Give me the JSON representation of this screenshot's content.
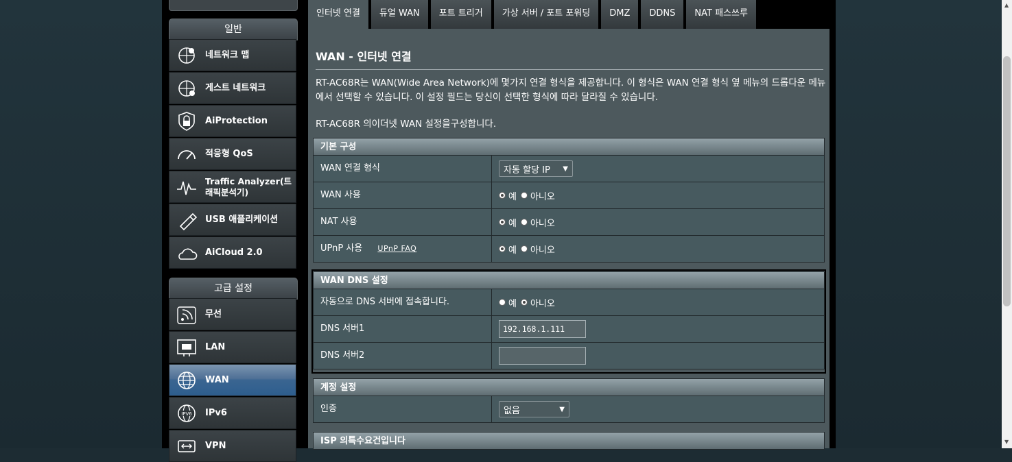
{
  "sidebar": {
    "group_general": "일반",
    "group_advanced": "고급 설정",
    "general_items": [
      {
        "label": "네트워크 맵",
        "icon": "network-map-icon"
      },
      {
        "label": "게스트 네트워크",
        "icon": "guest-network-icon"
      },
      {
        "label": "AiProtection",
        "icon": "lock-shield-icon"
      },
      {
        "label": "적응형 QoS",
        "icon": "speedometer-icon"
      },
      {
        "label": "Traffic Analyzer(트래픽분석기)",
        "icon": "traffic-analyzer-icon"
      },
      {
        "label": "USB 애플리케이션",
        "icon": "usb-icon"
      },
      {
        "label": "AiCloud 2.0",
        "icon": "cloud-icon"
      }
    ],
    "advanced_items": [
      {
        "label": "무선",
        "icon": "wireless-icon"
      },
      {
        "label": "LAN",
        "icon": "lan-icon"
      },
      {
        "label": "WAN",
        "icon": "globe-icon",
        "active": true
      },
      {
        "label": "IPv6",
        "icon": "ipv6-globe-icon"
      },
      {
        "label": "VPN",
        "icon": "vpn-icon"
      }
    ]
  },
  "tabs": [
    {
      "label": "인터넷 연결",
      "active": true
    },
    {
      "label": "듀얼 WAN"
    },
    {
      "label": "포트 트리거"
    },
    {
      "label": "가상 서버 / 포트 포워딩"
    },
    {
      "label": "DMZ"
    },
    {
      "label": "DDNS"
    },
    {
      "label": "NAT 패스쓰루"
    }
  ],
  "main": {
    "title": "WAN - 인터넷 연결",
    "description": "RT-AC68R는 WAN(Wide Area Network)에 몇가지 연결 형식을 제공합니다. 이 형식은 WAN 연결 형식 옆 메뉴의 드롭다운 메뉴에서 선택할 수 있습니다. 이 설정 필드는 당신이 선택한 형식에 따라 달라질 수 있습니다.",
    "description2": "RT-AC68R 의이더넷 WAN 설정을구성합니다.",
    "basic": {
      "header": "기본 구성",
      "wan_type_label": "WAN 연결 형식",
      "wan_type_value": "자동 할당 IP",
      "wan_enable_label": "WAN 사용",
      "nat_enable_label": "NAT 사용",
      "upnp_label": "UPnP 사용",
      "upnp_faq": "UPnP FAQ",
      "yes": "예",
      "no": "아니오"
    },
    "dns": {
      "header": "WAN DNS 설정",
      "auto_label": "자동으로 DNS 서버에 접속합니다.",
      "dns1_label": "DNS 서버1",
      "dns1_value": "192.168.1.111",
      "dns2_label": "DNS 서버2",
      "dns2_value": ""
    },
    "account": {
      "header": "계정 설정",
      "auth_label": "인증",
      "auth_value": "없음"
    },
    "isp": {
      "header": "ISP 의특수요건입니다"
    }
  },
  "colors": {
    "panel": "#4d595d",
    "active_menu": "#3a6591",
    "page_bg": "#1d2c33"
  }
}
